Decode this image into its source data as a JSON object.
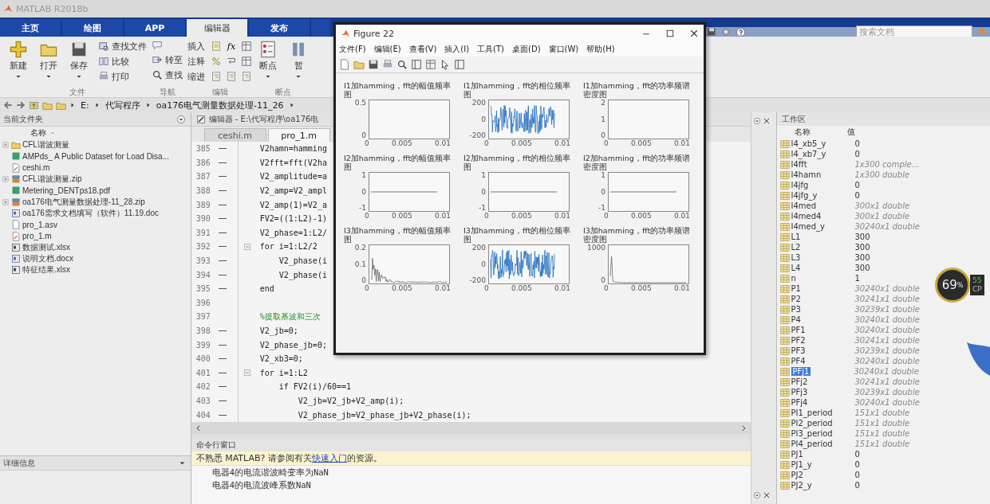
{
  "app_title": "MATLAB R2018b",
  "ribbon_tabs": [
    {
      "label": "主页",
      "selected": false
    },
    {
      "label": "绘图",
      "selected": false
    },
    {
      "label": "APP",
      "selected": false
    },
    {
      "label": "编辑器",
      "selected": true
    },
    {
      "label": "发布",
      "selected": false
    }
  ],
  "search": {
    "placeholder": "搜索文档"
  },
  "ribbon_groups": [
    {
      "label": "文件",
      "items": [
        {
          "kind": "large",
          "label": "新建"
        },
        {
          "kind": "large",
          "label": "打开"
        },
        {
          "kind": "large",
          "label": "保存"
        },
        {
          "kind": "stack",
          "rows": [
            {
              "label": "查找文件"
            },
            {
              "label": "比较"
            },
            {
              "label": "打印"
            }
          ]
        }
      ]
    },
    {
      "label": "导航",
      "items": [
        {
          "kind": "stack",
          "rows": [
            {
              "kind": "icon"
            },
            {
              "label": "转至"
            },
            {
              "label": "查找"
            }
          ]
        }
      ]
    },
    {
      "label": "编辑",
      "items": [
        {
          "kind": "grid",
          "rows": [
            {
              "label": "插入",
              "tools": [
                {
                  "kind": "docadd"
                },
                {
                  "kind": "symbol",
                  "text": "fx"
                },
                {
                  "kind": "table"
                }
              ]
            },
            {
              "label": "注释",
              "tools": [
                {
                  "kind": "percent"
                },
                {
                  "kind": "wrap"
                },
                {
                  "kind": "table"
                }
              ]
            },
            {
              "label": "缩进",
              "tools": [
                {
                  "kind": "indent"
                },
                {
                  "kind": "indent"
                },
                {
                  "kind": "indent"
                }
              ]
            }
          ]
        }
      ]
    },
    {
      "label": "断点",
      "items": [
        {
          "kind": "large",
          "label": "断点"
        },
        {
          "kind": "large",
          "label": "暂"
        }
      ]
    }
  ],
  "address": [
    "E:",
    "代写程序",
    "oa176电气测量数据处理-11_26"
  ],
  "files_panel": {
    "title": "当前文件夹",
    "column": "名称",
    "files": [
      {
        "name": "CFL谐波测量",
        "kind": "folder",
        "expandable": true
      },
      {
        "name": "AMPds_ A Public Dataset for Load Disa...",
        "kind": "pdf",
        "expandable": false
      },
      {
        "name": "ceshi.m",
        "kind": "m",
        "expandable": false
      },
      {
        "name": "CFL谐波测量.zip",
        "kind": "zip",
        "expandable": true
      },
      {
        "name": "Metering_DENTps18.pdf",
        "kind": "pdf",
        "expandable": false
      },
      {
        "name": "oa176电气测量数据处理-11_28.zip",
        "kind": "zip",
        "expandable": true
      },
      {
        "name": "oa176需求文档填写（软件）11.19.doc",
        "kind": "doc",
        "expandable": false
      },
      {
        "name": "pro_1.asv",
        "kind": "asv",
        "expandable": false
      },
      {
        "name": "pro_1.m",
        "kind": "m",
        "expandable": false
      },
      {
        "name": "数据测试.xlsx",
        "kind": "xlsx",
        "expandable": false
      },
      {
        "name": "说明文档.docx",
        "kind": "doc",
        "expandable": false
      },
      {
        "name": "特征结果.xlsx",
        "kind": "xlsx",
        "expandable": false
      }
    ]
  },
  "details": {
    "title": "详细信息"
  },
  "editor": {
    "title": "编辑器 - E:\\代写程序\\oa176电",
    "tabs": [
      {
        "label": "ceshi.m",
        "selected": false
      },
      {
        "label": "pro_1.m",
        "selected": true
      }
    ],
    "lines": [
      {
        "number": "385",
        "executable": true,
        "fold": false,
        "kind": "code",
        "text": "V2hamn=hamming"
      },
      {
        "number": "386",
        "executable": true,
        "fold": false,
        "kind": "code",
        "text": "V2fft=fft(V2ha"
      },
      {
        "number": "387",
        "executable": true,
        "fold": false,
        "kind": "code",
        "text": "V2_amplitude=a"
      },
      {
        "number": "388",
        "executable": true,
        "fold": false,
        "kind": "code",
        "text": "V2_amp=V2_ampl"
      },
      {
        "number": "389",
        "executable": true,
        "fold": false,
        "kind": "code",
        "text": "V2_amp(1)=V2_a"
      },
      {
        "number": "390",
        "executable": true,
        "fold": false,
        "kind": "code",
        "text": "FV2=((1:L2)-1)"
      },
      {
        "number": "391",
        "executable": true,
        "fold": false,
        "kind": "code",
        "text": "V2_phase=1:L2/"
      },
      {
        "number": "392",
        "executable": true,
        "fold": true,
        "kind": "code",
        "text": "for i=1:L2/2"
      },
      {
        "number": "393",
        "executable": true,
        "fold": false,
        "kind": "code",
        "text": "    V2_phase(i"
      },
      {
        "number": "394",
        "executable": true,
        "fold": false,
        "kind": "code",
        "text": "    V2_phase(i"
      },
      {
        "number": "395",
        "executable": true,
        "fold": false,
        "kind": "code",
        "text": "end"
      },
      {
        "number": "396",
        "executable": false,
        "fold": false
      },
      {
        "number": "397",
        "executable": false,
        "fold": false,
        "kind": "comment",
        "text": "%提取基波和三次"
      },
      {
        "number": "398",
        "executable": true,
        "fold": false,
        "kind": "code",
        "text": "V2_jb=0;"
      },
      {
        "number": "399",
        "executable": true,
        "fold": false,
        "kind": "code",
        "text": "V2_phase_jb=0;"
      },
      {
        "number": "400",
        "executable": true,
        "fold": false,
        "kind": "code",
        "text": "V2_xb3=0;"
      },
      {
        "number": "401",
        "executable": true,
        "fold": true,
        "kind": "code",
        "text": "for i=1:L2"
      },
      {
        "number": "402",
        "executable": true,
        "fold": false,
        "kind": "code",
        "text": "    if FV2(i)/60==1"
      },
      {
        "number": "403",
        "executable": true,
        "fold": false,
        "kind": "code",
        "text": "        V2_jb=V2_jb+V2_amp(i);"
      },
      {
        "number": "404",
        "executable": true,
        "fold": false,
        "kind": "code",
        "text": "        V2_phase_jb=V2_phase_jb+V2_phase(i);"
      }
    ]
  },
  "figure": {
    "title": "Figure 22",
    "menus": [
      "文件(F)",
      "编辑(E)",
      "查看(V)",
      "插入(I)",
      "工具(T)",
      "桌面(D)",
      "窗口(W)",
      "帮助(H)"
    ],
    "subplots": [
      {
        "title": "I1加hamming，fft的幅值频率图",
        "kind": "empty",
        "yticks": [
          "0.5",
          "0"
        ],
        "xticks": [
          "0",
          "0.005",
          "0.01"
        ]
      },
      {
        "title": "I1加hamming，fft的相位频率图",
        "kind": "noise",
        "yticks": [
          "200",
          "0",
          "-200"
        ],
        "xticks": [
          "0",
          "0.005",
          "0.01"
        ]
      },
      {
        "title": "I1加hamming，fft的功率频谱密度图",
        "kind": "empty",
        "yticks": [
          "2",
          "1",
          "0"
        ],
        "xticks": [
          "0",
          "0.005",
          "0.01"
        ]
      },
      {
        "title": "I2加hamming，fft的幅值频率图",
        "kind": "flat",
        "yticks": [
          "1",
          "0",
          "-1"
        ],
        "xticks": [
          "0",
          "0.005",
          "0.01"
        ]
      },
      {
        "title": "I2加hamming，fft的相位频率图",
        "kind": "flat",
        "yticks": [
          "1",
          "0",
          "-1"
        ],
        "xticks": [
          "0",
          "0.005",
          "0.01"
        ]
      },
      {
        "title": "I2加hamming，fft的功率频谱密度图",
        "kind": "flat",
        "yticks": [
          "1",
          "0",
          "-1"
        ],
        "xticks": [
          "0",
          "0.005",
          "0.01"
        ]
      },
      {
        "title": "I3加hamming，fft的幅值频率图",
        "kind": "decay",
        "yticks": [
          "0.2",
          "0.1",
          "0"
        ],
        "xticks": [
          "0",
          "0.005",
          "0.01"
        ]
      },
      {
        "title": "I3加hamming，fft的相位频率图",
        "kind": "noise",
        "yticks": [
          "200",
          "0",
          "-200"
        ],
        "xticks": [
          "0",
          "0.005",
          "0.01"
        ]
      },
      {
        "title": "I3加hamming，fft的功率频谱密度图",
        "kind": "spike",
        "yticks": [
          "1000",
          "0"
        ],
        "xticks": [
          "0",
          "0.005",
          "0.01"
        ]
      }
    ]
  },
  "command_window": {
    "title": "命令行窗口",
    "notice_before": "不熟悉 MATLAB? 请参阅有关",
    "notice_link": "快速入门",
    "notice_after": "的资源。",
    "output": [
      "电器4的电流谐波畸变率为NaN",
      "电器4的电流波峰系数NaN"
    ]
  },
  "workspace": {
    "title": "工作区",
    "columns": [
      "名称",
      "值"
    ],
    "variables": [
      {
        "name": "I4_xb5_y",
        "value": "0",
        "kind": "scalar",
        "selected": false
      },
      {
        "name": "I4_xb7_y",
        "value": "0",
        "kind": "scalar",
        "selected": false
      },
      {
        "name": "I4fft",
        "value": "1x300 comple...",
        "kind": "array",
        "selected": false
      },
      {
        "name": "I4hamn",
        "value": "1x300 double",
        "kind": "array",
        "selected": false
      },
      {
        "name": "I4jfg",
        "value": "0",
        "kind": "scalar",
        "selected": false
      },
      {
        "name": "I4jfg_y",
        "value": "0",
        "kind": "scalar",
        "selected": false
      },
      {
        "name": "I4med",
        "value": "300x1 double",
        "kind": "array",
        "selected": false
      },
      {
        "name": "I4med4",
        "value": "300x1 double",
        "kind": "array",
        "selected": false
      },
      {
        "name": "I4med_y",
        "value": "30240x1 double",
        "kind": "array",
        "selected": false
      },
      {
        "name": "L1",
        "value": "300",
        "kind": "scalar",
        "selected": false
      },
      {
        "name": "L2",
        "value": "300",
        "kind": "scalar",
        "selected": false
      },
      {
        "name": "L3",
        "value": "300",
        "kind": "scalar",
        "selected": false
      },
      {
        "name": "L4",
        "value": "300",
        "kind": "scalar",
        "selected": false
      },
      {
        "name": "n",
        "value": "1",
        "kind": "scalar",
        "selected": false
      },
      {
        "name": "P1",
        "value": "30240x1 double",
        "kind": "array",
        "selected": false
      },
      {
        "name": "P2",
        "value": "30241x1 double",
        "kind": "array",
        "selected": false
      },
      {
        "name": "P3",
        "value": "30239x1 double",
        "kind": "array",
        "selected": false
      },
      {
        "name": "P4",
        "value": "30240x1 double",
        "kind": "array",
        "selected": false
      },
      {
        "name": "PF1",
        "value": "30240x1 double",
        "kind": "array",
        "selected": false
      },
      {
        "name": "PF2",
        "value": "30241x1 double",
        "kind": "array",
        "selected": false
      },
      {
        "name": "PF3",
        "value": "30239x1 double",
        "kind": "array",
        "selected": false
      },
      {
        "name": "PF4",
        "value": "30240x1 double",
        "kind": "array",
        "selected": false
      },
      {
        "name": "PFj1",
        "value": "30240x1 double",
        "kind": "array",
        "selected": true
      },
      {
        "name": "PFj2",
        "value": "30241x1 double",
        "kind": "array",
        "selected": false
      },
      {
        "name": "PFj3",
        "value": "30239x1 double",
        "kind": "array",
        "selected": false
      },
      {
        "name": "PFj4",
        "value": "30240x1 double",
        "kind": "array",
        "selected": false
      },
      {
        "name": "PI1_period",
        "value": "151x1 double",
        "kind": "array",
        "selected": false
      },
      {
        "name": "PI2_period",
        "value": "151x1 double",
        "kind": "array",
        "selected": false
      },
      {
        "name": "PI3_period",
        "value": "151x1 double",
        "kind": "array",
        "selected": false
      },
      {
        "name": "PI4_period",
        "value": "151x1 double",
        "kind": "array",
        "selected": false
      },
      {
        "name": "PJ1",
        "value": "0",
        "kind": "scalar",
        "selected": false
      },
      {
        "name": "PJ1_y",
        "value": "0",
        "kind": "scalar",
        "selected": false
      },
      {
        "name": "PJ2",
        "value": "0",
        "kind": "scalar",
        "selected": false
      },
      {
        "name": "PJ2_y",
        "value": "0",
        "kind": "scalar",
        "selected": false
      }
    ]
  },
  "cpu_gauge": {
    "percent": "69",
    "unit": "%",
    "side_value": "55",
    "side_label": "CP"
  }
}
